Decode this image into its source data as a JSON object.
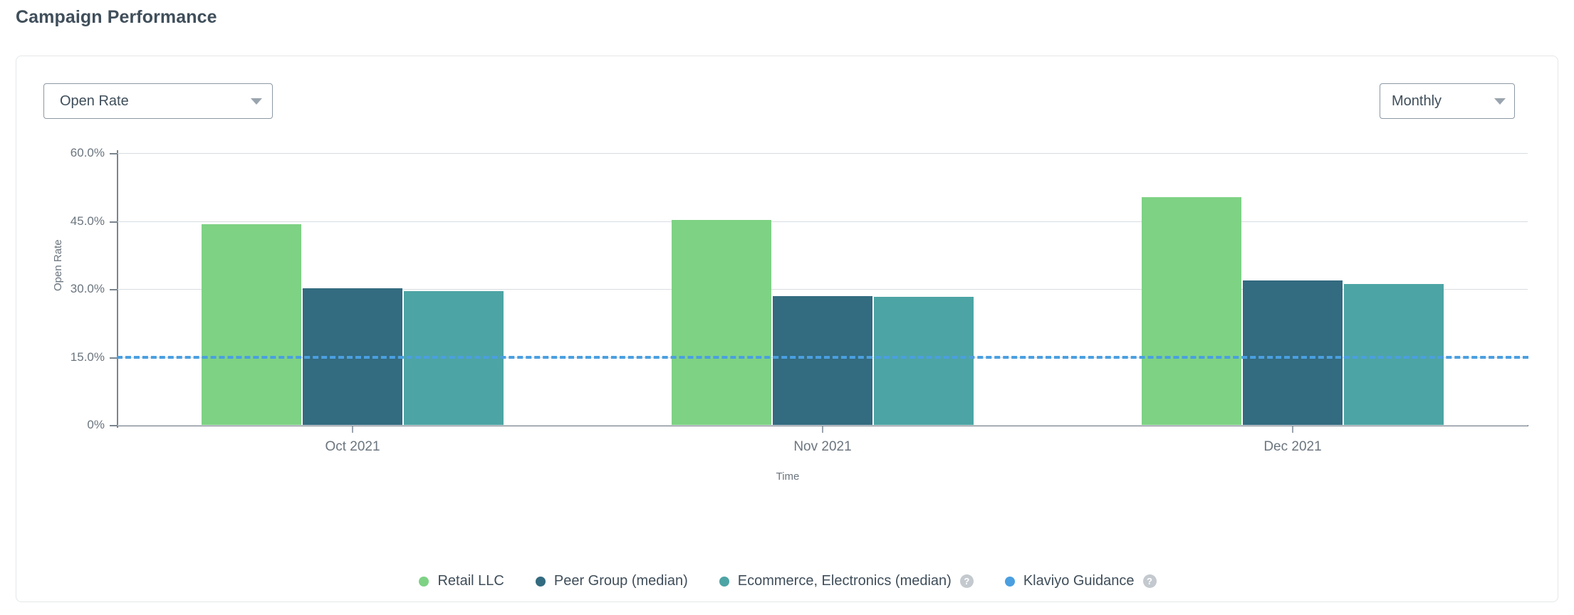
{
  "page_title": "Campaign Performance",
  "controls": {
    "metric_select": {
      "value": "Open Rate",
      "caret": "chevron-down-icon"
    },
    "interval_select": {
      "value": "Monthly",
      "caret": "chevron-down-icon"
    }
  },
  "colors": {
    "retail": "#7ed284",
    "peer_group": "#336b80",
    "ecommerce": "#4da4a4",
    "guidance": "#4a9fe0",
    "grid": "#d9dde1",
    "axis": "#7b858e",
    "text": "#3f4e5a"
  },
  "legend": {
    "items": [
      {
        "label": "Retail LLC",
        "color": "#7ed284",
        "help": false
      },
      {
        "label": "Peer Group (median)",
        "color": "#336b80",
        "help": false
      },
      {
        "label": "Ecommerce, Electronics (median)",
        "color": "#4da4a4",
        "help": true,
        "help_glyph": "?"
      },
      {
        "label": "Klaviyo Guidance",
        "color": "#4a9fe0",
        "help": true,
        "help_glyph": "?"
      }
    ]
  },
  "chart_data": {
    "type": "bar",
    "title": "Campaign Performance",
    "xlabel": "Time",
    "ylabel": "Open Rate",
    "categories": [
      "Oct 2021",
      "Nov 2021",
      "Dec 2021"
    ],
    "ylim": [
      0,
      60
    ],
    "yticks": [
      0,
      15,
      30,
      45,
      60
    ],
    "ytick_labels": [
      "0%",
      "15.0%",
      "30.0%",
      "45.0%",
      "60.0%"
    ],
    "grid": true,
    "legend_position": "bottom",
    "series": [
      {
        "name": "Retail LLC",
        "color": "#7ed284",
        "values": [
          44.3,
          45.2,
          50.2
        ]
      },
      {
        "name": "Peer Group (median)",
        "color": "#336b80",
        "values": [
          30.2,
          28.5,
          31.9
        ]
      },
      {
        "name": "Ecommerce, Electronics (median)",
        "color": "#4da4a4",
        "values": [
          29.5,
          28.3,
          31.1
        ]
      }
    ],
    "reference_line": {
      "name": "Klaviyo Guidance",
      "value": 15.0,
      "color": "#4a9fe0",
      "style": "dashed"
    }
  }
}
